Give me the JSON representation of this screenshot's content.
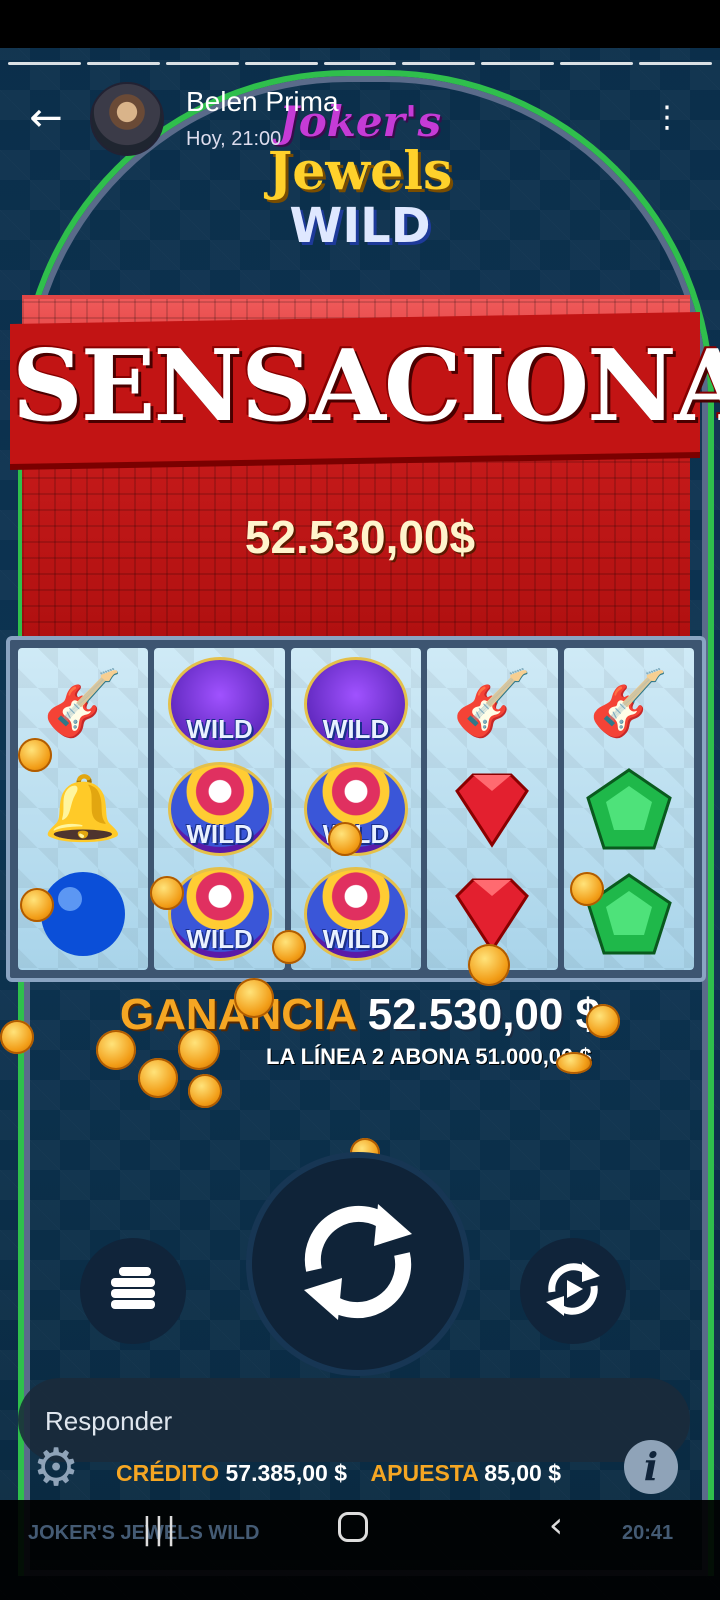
{
  "story": {
    "user_name": "Belen Prima",
    "timestamp": "Hoy, 21:00",
    "back_icon": "arrow-left-icon",
    "menu_icon": "more-vertical-icon",
    "progress_segments": 9
  },
  "game": {
    "logo": {
      "line1": "Joker's",
      "line2": "Jewels",
      "line3": "WILD"
    },
    "win_banner": "SENSACIONAL!",
    "win_amount": "52.530,00$",
    "reels": [
      [
        "mandolin",
        "bell",
        "blue-orb"
      ],
      [
        "wild-purple",
        "wild-joker",
        "wild-joker"
      ],
      [
        "wild-purple",
        "wild-joker",
        "wild-joker"
      ],
      [
        "mandolin",
        "red-gem",
        "red-gem"
      ],
      [
        "mandolin",
        "green-gem",
        "green-gem"
      ]
    ],
    "wild_label": "WILD",
    "win_label": "GANANCIA",
    "win_value": "52.530,00 $",
    "line_pays": "LA LÍNEA 2 ABONA 51.000,00 $",
    "credit_label": "CRÉDITO",
    "credit_value": "57.385,00 $",
    "bet_label": "APUESTA",
    "bet_value": "85,00 $",
    "footer_title": "JOKER'S JEWELS WILD",
    "clock": "20:41"
  },
  "reply": {
    "placeholder": "Responder"
  },
  "colors": {
    "accent_gold": "#f5a623",
    "banner_red": "#c21414",
    "frame_green": "#2fbf4c"
  }
}
